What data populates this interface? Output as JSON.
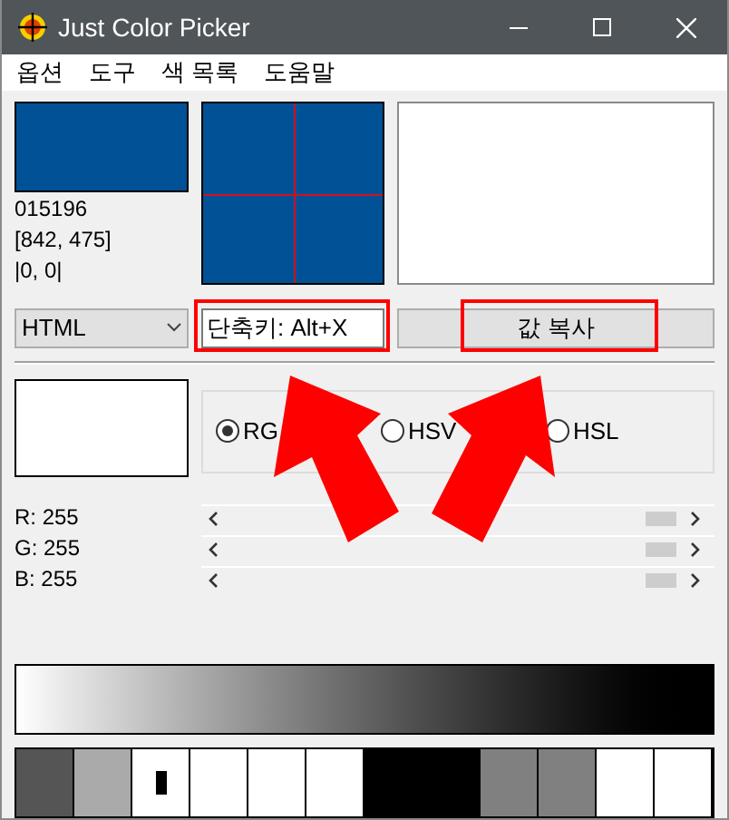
{
  "window": {
    "title": "Just Color Picker"
  },
  "menu": [
    "옵션",
    "도구",
    "색 목록",
    "도움말"
  ],
  "picked": {
    "color": "#015196",
    "hex": "015196",
    "position": "[842, 475]",
    "offset": "|0, 0|"
  },
  "format": {
    "value": "HTML"
  },
  "shortcut": {
    "value": "단축키: Alt+X"
  },
  "copy_button": "값 복사",
  "modes": [
    {
      "label": "RG",
      "selected": true
    },
    {
      "label": "HSV",
      "selected": false
    },
    {
      "label": "HSL",
      "selected": false
    }
  ],
  "channels": [
    {
      "name": "R: 255",
      "level": 1
    },
    {
      "name": "G: 255",
      "level": 1
    },
    {
      "name": "B: 255",
      "level": 1
    }
  ],
  "swatches": [
    {
      "color": "#555555",
      "selected": false
    },
    {
      "color": "#aaaaaa",
      "selected": false
    },
    {
      "color": "#ffffff",
      "selected": true
    },
    {
      "color": "#ffffff",
      "selected": false
    },
    {
      "color": "#ffffff",
      "selected": false
    },
    {
      "color": "#ffffff",
      "selected": false
    },
    {
      "color": "#000000",
      "selected": false
    },
    {
      "color": "#000000",
      "selected": false
    },
    {
      "color": "#808080",
      "selected": false
    },
    {
      "color": "#808080",
      "selected": false
    },
    {
      "color": "#ffffff",
      "selected": false
    },
    {
      "color": "#ffffff",
      "selected": false
    }
  ],
  "annotations": [
    {
      "kind": "frame"
    },
    {
      "kind": "frame"
    },
    {
      "kind": "arrow"
    },
    {
      "kind": "arrow"
    }
  ]
}
